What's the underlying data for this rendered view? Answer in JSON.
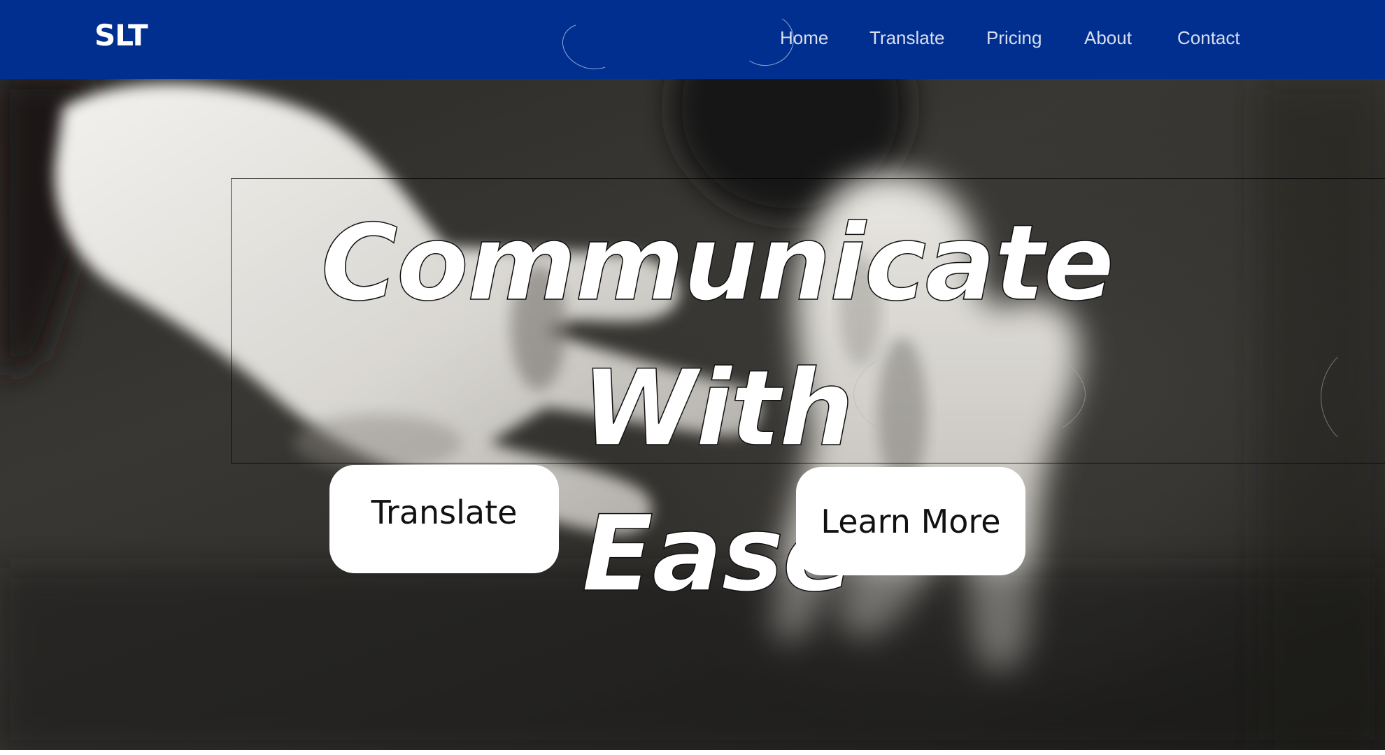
{
  "brand": {
    "logo_text": "SLT"
  },
  "nav": {
    "items": [
      {
        "label": "Home"
      },
      {
        "label": "Translate"
      },
      {
        "label": "Pricing"
      },
      {
        "label": "About"
      },
      {
        "label": "Contact"
      }
    ]
  },
  "hero": {
    "headline_line1": "Communicate With",
    "headline_line2": "Ease",
    "background_image": "black-and-white photo of two hands making sign language gestures",
    "buttons": {
      "translate_label": "Translate",
      "learn_more_label": "Learn More"
    }
  },
  "colors": {
    "navbar_bg": "#002f8f",
    "nav_text": "#d8def0",
    "button_bg": "#ffffff",
    "button_text": "#111111",
    "headline_text": "#ffffff"
  },
  "icons": [
    "hands-photo"
  ]
}
